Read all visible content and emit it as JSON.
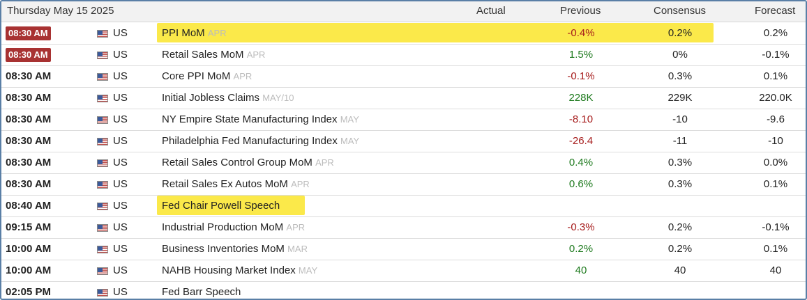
{
  "header": {
    "date": "Thursday May 15 2025",
    "col_actual": "Actual",
    "col_previous": "Previous",
    "col_consensus": "Consensus",
    "col_forecast": "Forecast"
  },
  "rows": [
    {
      "time": "08:30 AM",
      "badge": true,
      "country": "US",
      "event": "PPI MoM",
      "period": "APR",
      "previous": "-0.4%",
      "previous_tone": "neg",
      "consensus": "0.2%",
      "forecast": "0.2%",
      "highlight": true
    },
    {
      "time": "08:30 AM",
      "badge": true,
      "country": "US",
      "event": "Retail Sales MoM",
      "period": "APR",
      "previous": "1.5%",
      "previous_tone": "pos",
      "consensus": "0%",
      "forecast": "-0.1%"
    },
    {
      "time": "08:30 AM",
      "country": "US",
      "event": "Core PPI MoM",
      "period": "APR",
      "previous": "-0.1%",
      "previous_tone": "neg",
      "consensus": "0.3%",
      "forecast": "0.1%"
    },
    {
      "time": "08:30 AM",
      "country": "US",
      "event": "Initial Jobless Claims",
      "period": "MAY/10",
      "previous": "228K",
      "previous_tone": "pos",
      "consensus": "229K",
      "forecast": "220.0K"
    },
    {
      "time": "08:30 AM",
      "country": "US",
      "event": "NY Empire State Manufacturing Index",
      "period": "MAY",
      "previous": "-8.10",
      "previous_tone": "neg",
      "consensus": "-10",
      "forecast": "-9.6"
    },
    {
      "time": "08:30 AM",
      "country": "US",
      "event": "Philadelphia Fed Manufacturing Index",
      "period": "MAY",
      "previous": "-26.4",
      "previous_tone": "neg",
      "consensus": "-11",
      "forecast": "-10"
    },
    {
      "time": "08:30 AM",
      "country": "US",
      "event": "Retail Sales Control Group MoM",
      "period": "APR",
      "previous": "0.4%",
      "previous_tone": "pos",
      "consensus": "0.3%",
      "forecast": "0.0%"
    },
    {
      "time": "08:30 AM",
      "country": "US",
      "event": "Retail Sales Ex Autos MoM",
      "period": "APR",
      "previous": "0.6%",
      "previous_tone": "pos",
      "consensus": "0.3%",
      "forecast": "0.1%"
    },
    {
      "time": "08:40 AM",
      "country": "US",
      "event": "Fed Chair Powell Speech",
      "period": "",
      "previous": "",
      "consensus": "",
      "forecast": "",
      "highlight": true
    },
    {
      "time": "09:15 AM",
      "country": "US",
      "event": "Industrial Production MoM",
      "period": "APR",
      "previous": "-0.3%",
      "previous_tone": "neg",
      "consensus": "0.2%",
      "forecast": "-0.1%"
    },
    {
      "time": "10:00 AM",
      "country": "US",
      "event": "Business Inventories MoM",
      "period": "MAR",
      "previous": "0.2%",
      "previous_tone": "pos",
      "consensus": "0.2%",
      "forecast": "0.1%"
    },
    {
      "time": "10:00 AM",
      "country": "US",
      "event": "NAHB Housing Market Index",
      "period": "MAY",
      "previous": "40",
      "previous_tone": "pos",
      "consensus": "40",
      "forecast": "40"
    },
    {
      "time": "02:05 PM",
      "country": "US",
      "event": "Fed Barr Speech",
      "period": "",
      "previous": "",
      "consensus": "",
      "forecast": ""
    }
  ],
  "colors": {
    "badge": "#a83232",
    "highlight": "#fbe94a",
    "negative": "#a61c1c",
    "positive": "#1e7a1e"
  },
  "icons": {
    "flag": "us-flag-icon"
  }
}
